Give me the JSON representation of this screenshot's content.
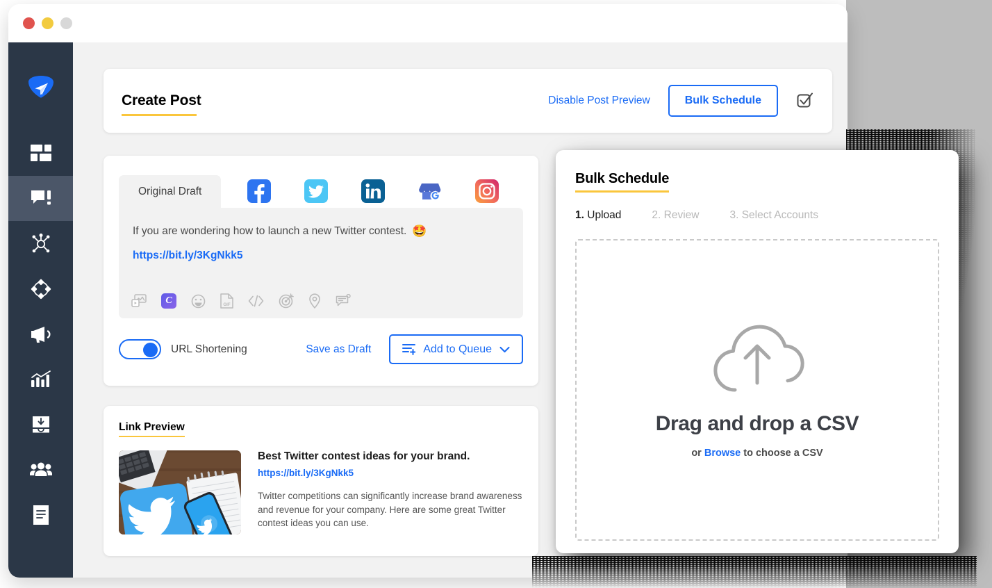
{
  "window": {
    "traffic_lights": [
      "close",
      "minimize",
      "maximize"
    ]
  },
  "sidebar": {
    "items": [
      {
        "name": "logo",
        "icon": "paper-plane-logo-icon",
        "label": ""
      },
      {
        "name": "dashboard",
        "icon": "dashboard-grid-icon",
        "label": ""
      },
      {
        "name": "publish",
        "icon": "chat-publish-icon",
        "label": "",
        "active": true
      },
      {
        "name": "engage",
        "icon": "network-share-icon",
        "label": ""
      },
      {
        "name": "discovery",
        "icon": "diamond-cluster-icon",
        "label": ""
      },
      {
        "name": "campaigns",
        "icon": "megaphone-icon",
        "label": ""
      },
      {
        "name": "analytics",
        "icon": "bar-chart-icon",
        "label": ""
      },
      {
        "name": "inbox",
        "icon": "inbox-download-icon",
        "label": ""
      },
      {
        "name": "team",
        "icon": "people-group-icon",
        "label": ""
      },
      {
        "name": "reports",
        "icon": "document-report-icon",
        "label": ""
      }
    ]
  },
  "header": {
    "title": "Create Post",
    "disable_preview_label": "Disable Post Preview",
    "bulk_schedule_label": "Bulk Schedule",
    "checkbox_icon": "checkbox-check-icon"
  },
  "composer": {
    "tabs": [
      {
        "label": "Original Draft",
        "icon": "",
        "active": true
      },
      {
        "label": "",
        "icon": "facebook-icon"
      },
      {
        "label": "",
        "icon": "twitter-icon"
      },
      {
        "label": "",
        "icon": "linkedin-icon"
      },
      {
        "label": "",
        "icon": "google-business-icon"
      },
      {
        "label": "",
        "icon": "instagram-icon"
      }
    ],
    "text": "If you are wondering how to launch a new Twitter contest.",
    "emoji": "🤩",
    "link": "https://bit.ly/3KgNkk5",
    "toolbar": [
      {
        "icon": "media-image-icon"
      },
      {
        "icon": "canva-icon",
        "letter": "C"
      },
      {
        "icon": "emoji-smile-icon"
      },
      {
        "icon": "gif-file-icon",
        "letter": "GIF"
      },
      {
        "icon": "code-embed-icon"
      },
      {
        "icon": "target-icon"
      },
      {
        "icon": "location-pin-icon"
      },
      {
        "icon": "note-comment-icon"
      }
    ],
    "url_shortening_label": "URL Shortening",
    "url_shortening_on": true,
    "save_draft_label": "Save as Draft",
    "add_to_queue_label": "Add to Queue",
    "queue_icon": "queue-add-icon",
    "chevron_icon": "chevron-down-icon"
  },
  "link_preview": {
    "section_title": "Link Preview",
    "title": "Best Twitter contest ideas for your brand.",
    "url": "https://bit.ly/3KgNkk5",
    "description": "Twitter competitions can significantly increase brand awareness and revenue for your company. Here are some great Twitter contest ideas you can use.",
    "thumbnail_alt": "twitter-logo-desk-photo"
  },
  "bulk_schedule": {
    "title": "Bulk Schedule",
    "steps": [
      {
        "number": "1.",
        "label": "Upload",
        "active": true
      },
      {
        "number": "2.",
        "label": "Review",
        "active": false
      },
      {
        "number": "3.",
        "label": "Select Accounts",
        "active": false
      }
    ],
    "dropzone": {
      "icon": "cloud-upload-icon",
      "title": "Drag and drop a CSV",
      "sub_prefix": "or ",
      "browse_label": "Browse",
      "sub_suffix": " to choose a CSV"
    }
  },
  "colors": {
    "accent_blue": "#1a6bf5",
    "accent_yellow": "#fac63c",
    "sidebar_bg": "#2b3747",
    "content_bg": "#f2f2f2"
  }
}
